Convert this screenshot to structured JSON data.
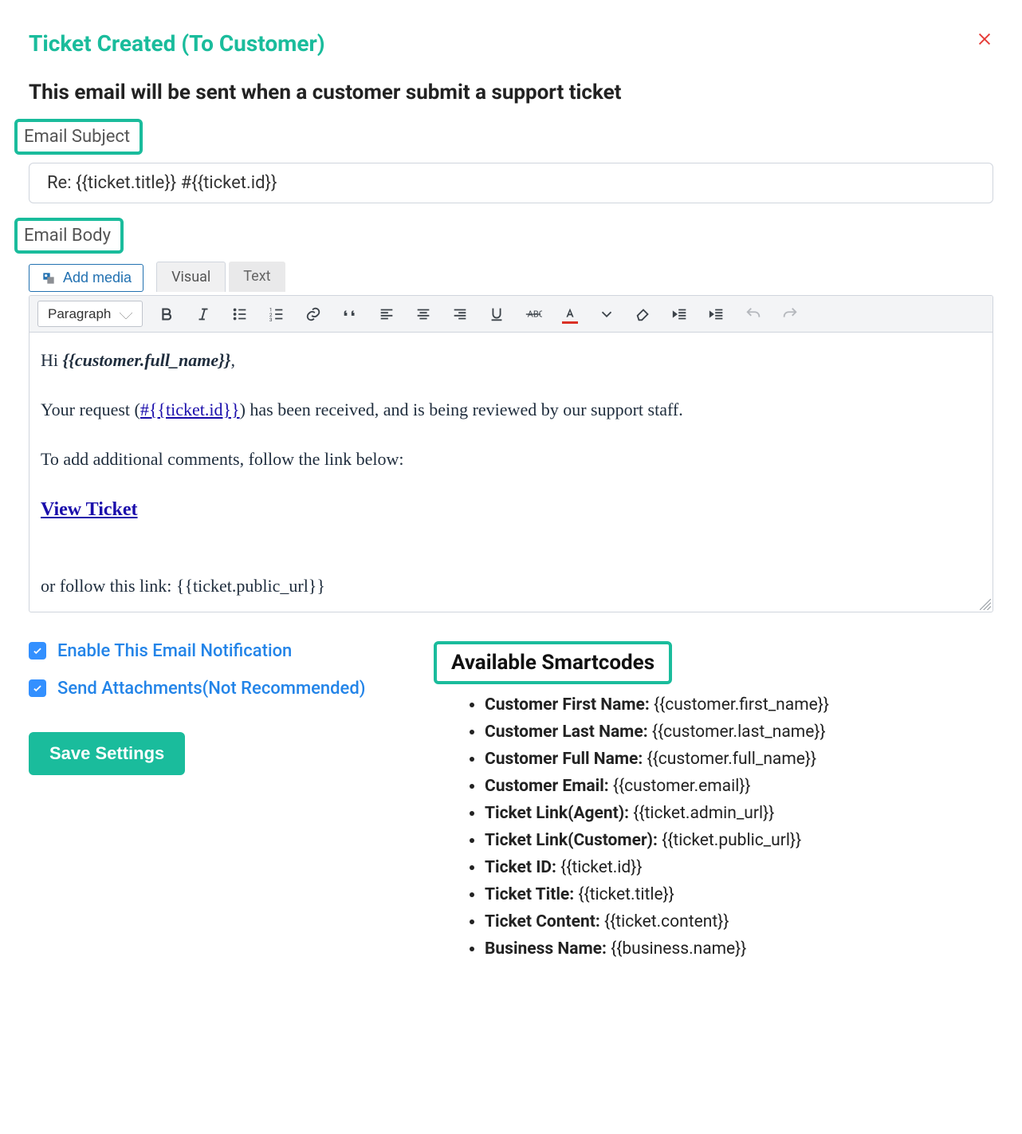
{
  "header": {
    "title": "Ticket Created (To Customer)"
  },
  "description": "This email will be sent when a customer submit a support ticket",
  "subject": {
    "label": "Email Subject",
    "value": "Re: {{ticket.title}} #{{ticket.id}}"
  },
  "body": {
    "label": "Email Body",
    "add_media": "Add media",
    "tabs": {
      "visual": "Visual",
      "text": "Text"
    },
    "format_selected": "Paragraph"
  },
  "body_content": {
    "greeting_prefix": "Hi ",
    "greeting_name": "{{customer.full_name}}",
    "greeting_suffix": ",",
    "line1_pre": "Your request (",
    "line1_link": "#{{ticket.id}}",
    "line1_post": ") has been received, and is being reviewed by our support staff.",
    "line2": "To add additional comments, follow the link below:",
    "view_ticket": "View Ticket",
    "line3": "or follow this link: {{ticket.public_url}}"
  },
  "options": {
    "enable_notification": "Enable This Email Notification",
    "send_attachments": "Send Attachments(Not Recommended)",
    "save": "Save Settings"
  },
  "smartcodes": {
    "title": "Available Smartcodes",
    "items": [
      {
        "label": "Customer First Name:",
        "code": "{{customer.first_name}}"
      },
      {
        "label": "Customer Last Name:",
        "code": "{{customer.last_name}}"
      },
      {
        "label": "Customer Full Name:",
        "code": "{{customer.full_name}}"
      },
      {
        "label": "Customer Email:",
        "code": "{{customer.email}}"
      },
      {
        "label": "Ticket Link(Agent):",
        "code": "{{ticket.admin_url}}"
      },
      {
        "label": "Ticket Link(Customer):",
        "code": "{{ticket.public_url}}"
      },
      {
        "label": "Ticket ID:",
        "code": "{{ticket.id}}"
      },
      {
        "label": "Ticket Title:",
        "code": "{{ticket.title}}"
      },
      {
        "label": "Ticket Content:",
        "code": "{{ticket.content}}"
      },
      {
        "label": "Business Name:",
        "code": "{{business.name}}"
      }
    ]
  }
}
